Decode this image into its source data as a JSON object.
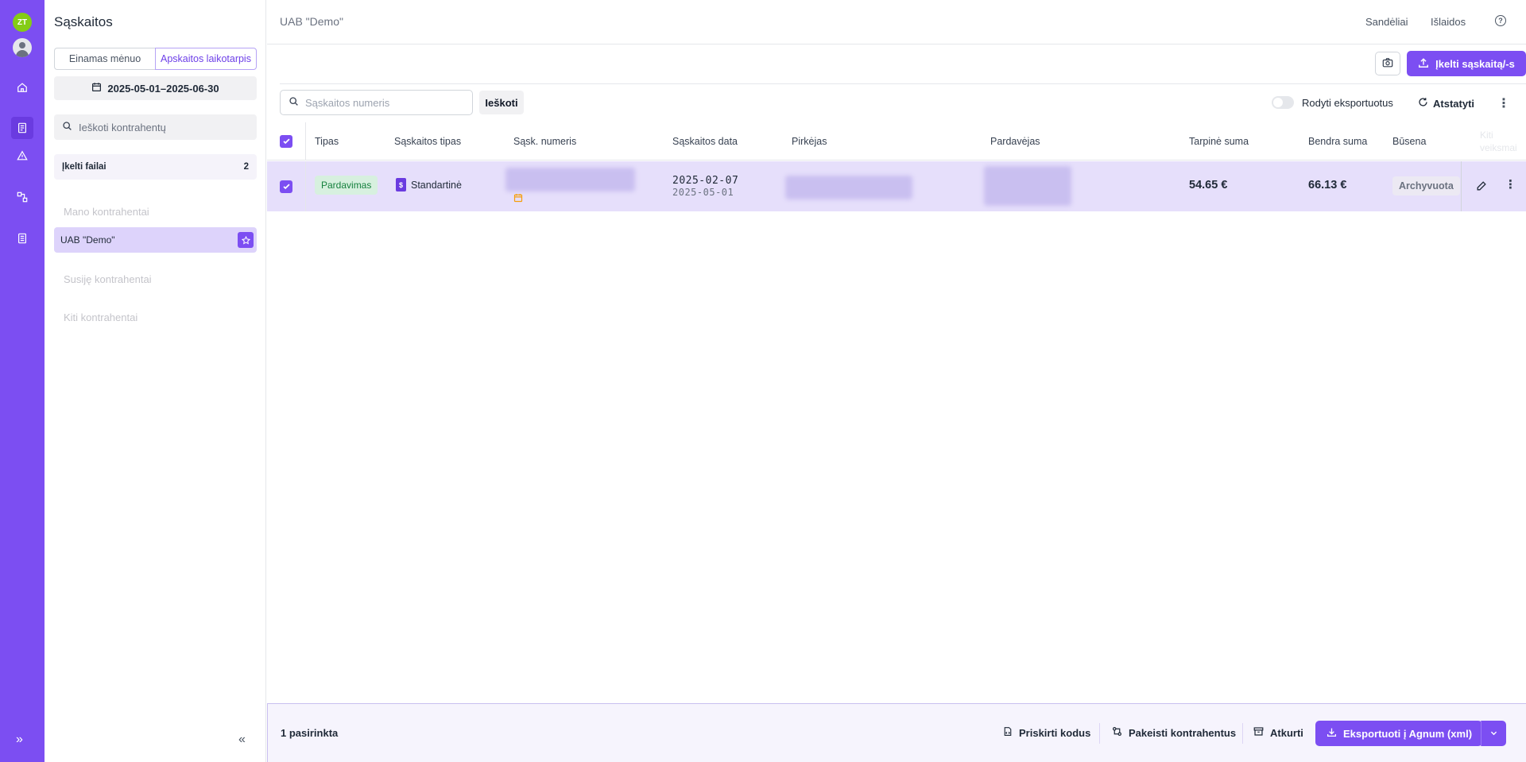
{
  "rail": {
    "avatar_initials": "ZT",
    "icons": [
      "home-icon",
      "invoices-icon",
      "warning-icon",
      "connections-icon",
      "report-icon"
    ],
    "expand_label": "»"
  },
  "sidebar": {
    "title": "Sąskaitos",
    "period_tabs": [
      "Einamas mėnuo",
      "Apskaitos laikotarpis"
    ],
    "date_range": "2025-05-01–2025-06-30",
    "search_placeholder": "Ieškoti kontrahentų",
    "uploaded_files_label": "Įkelti failai",
    "uploaded_files_count": "2",
    "my_contractors_heading": "Mano kontrahentai",
    "contractor_selected": "UAB \"Demo\"",
    "linked_contractors_heading": "Susiję kontrahentai",
    "other_contractors_heading": "Kiti kontrahentai",
    "collapse_label": "«"
  },
  "header": {
    "company": "UAB \"Demo\"",
    "links": [
      "Sandėliai",
      "Išlaidos"
    ],
    "help_label": "?"
  },
  "actions": {
    "upload_label": "Įkelti sąskaitą/-s"
  },
  "filters": {
    "search_placeholder": "Sąskaitos numeris",
    "search_button": "Ieškoti",
    "show_exported_label": "Rodyti eksportuotus",
    "show_exported": false,
    "reset_label": "Atstatyti"
  },
  "table": {
    "columns": [
      "Tipas",
      "Sąskaitos tipas",
      "Sąsk. numeris",
      "Sąskaitos data",
      "Pirkėjas",
      "Pardavėjas",
      "Tarpinė suma",
      "Bendra suma",
      "Būsena"
    ],
    "ghost_header": "Kiti veiksmai",
    "rows": [
      {
        "selected": true,
        "type": "Pardavimas",
        "invoice_type": "Standartinė",
        "invoice_date": "2025-02-07",
        "period_date": "2025-05-01",
        "subtotal": "54.65 €",
        "total": "66.13 €",
        "status": "Archyvuota"
      }
    ]
  },
  "bottombar": {
    "selected_count": "1 pasirinkta",
    "assign_codes": "Priskirti kodus",
    "change_contractors": "Pakeisti kontrahentus",
    "restore": "Atkurti",
    "export": "Eksportuoti į Agnum (xml)"
  },
  "colors": {
    "accent": "#7c4ef2",
    "row_selected": "#e6dffb",
    "badge_sale_bg": "#d7f0df",
    "badge_sale_text": "#15803d"
  }
}
